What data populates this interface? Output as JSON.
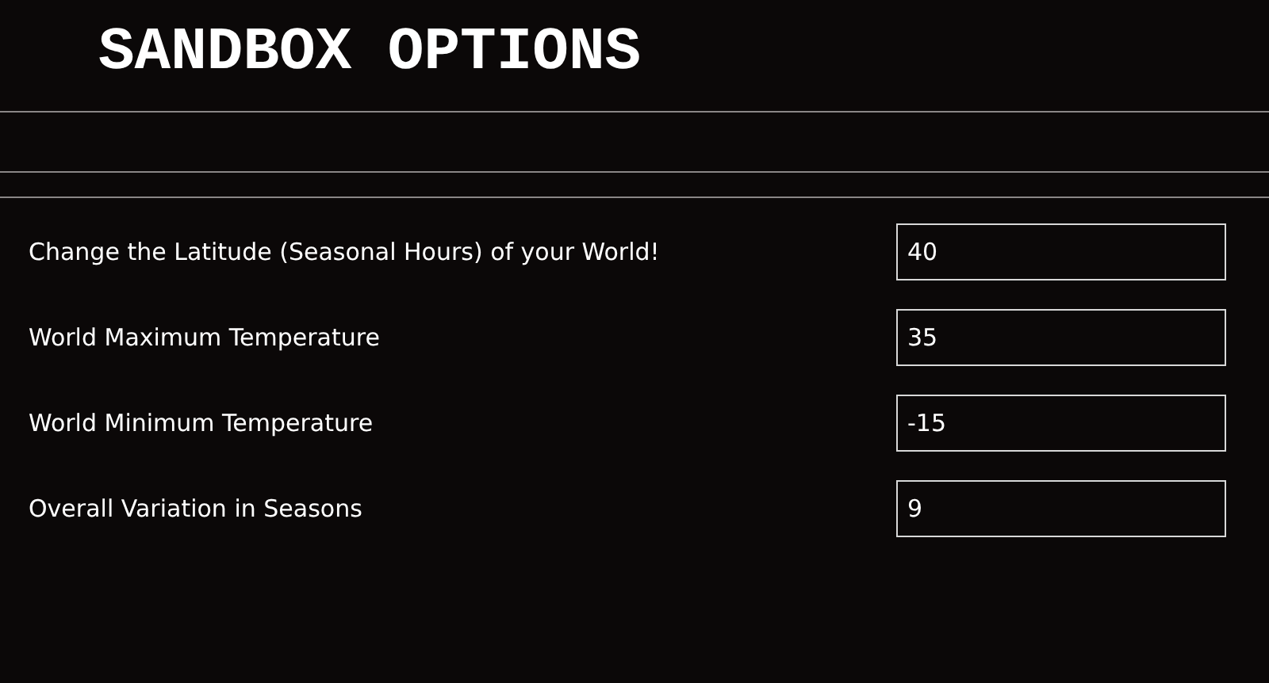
{
  "title": "SANDBOX OPTIONS",
  "options": [
    {
      "label": "Change the Latitude (Seasonal Hours) of your World!",
      "value": "40"
    },
    {
      "label": "World Maximum Temperature",
      "value": "35"
    },
    {
      "label": "World Minimum Temperature",
      "value": "-15"
    },
    {
      "label": "Overall Variation in Seasons",
      "value": "9"
    }
  ]
}
